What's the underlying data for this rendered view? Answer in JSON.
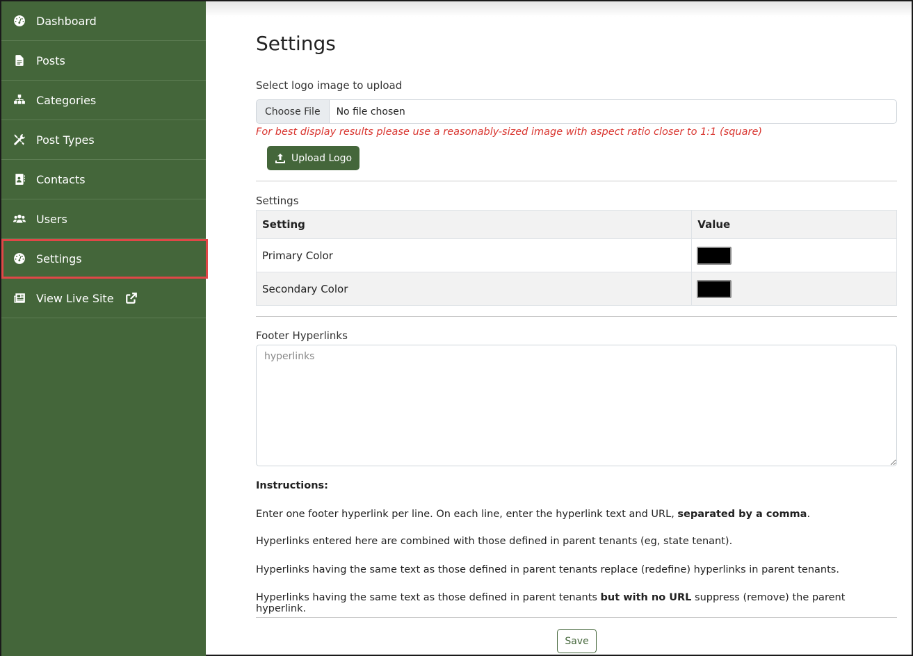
{
  "sidebar": {
    "items": [
      {
        "label": "Dashboard",
        "icon": "dashboard-icon"
      },
      {
        "label": "Posts",
        "icon": "file-icon"
      },
      {
        "label": "Categories",
        "icon": "categories-icon"
      },
      {
        "label": "Post Types",
        "icon": "tools-icon"
      },
      {
        "label": "Contacts",
        "icon": "address-book-icon"
      },
      {
        "label": "Users",
        "icon": "users-icon"
      },
      {
        "label": "Settings",
        "icon": "dashboard-icon",
        "active": true
      },
      {
        "label": "View Live Site",
        "icon": "newspaper-icon",
        "external_icon": "external-link-icon"
      }
    ],
    "background_color": "#44663a",
    "highlight_color": "#e04747"
  },
  "main": {
    "title": "Settings",
    "logo": {
      "label": "Select logo image to upload",
      "choose_file_label": "Choose File",
      "file_status": "No file chosen",
      "hint": "For best display results please use a reasonably-sized image with aspect ratio closer to 1:1 (square)",
      "upload_label": "Upload Logo"
    },
    "settings": {
      "label": "Settings",
      "headers": [
        "Setting",
        "Value"
      ],
      "rows": [
        {
          "name": "Primary Color",
          "value": "#000000"
        },
        {
          "name": "Secondary Color",
          "value": "#000000"
        }
      ]
    },
    "footer": {
      "label": "Footer Hyperlinks",
      "placeholder": "hyperlinks",
      "value": ""
    },
    "instructions": {
      "title": "Instructions:",
      "line1_pre": "Enter one footer hyperlink per line. On each line, enter the hyperlink text and URL, ",
      "line1_bold": "separated by a comma",
      "line1_post": ".",
      "line2": "Hyperlinks entered here are combined with those defined in parent tenants (eg, state tenant).",
      "line3": "Hyperlinks having the same text as those defined in parent tenants replace (redefine) hyperlinks in parent tenants.",
      "line4_pre": "Hyperlinks having the same text as those defined in parent tenants ",
      "line4_bold": "but with no URL",
      "line4_post": " suppress (remove) the parent hyperlink."
    },
    "save_label": "Save"
  }
}
